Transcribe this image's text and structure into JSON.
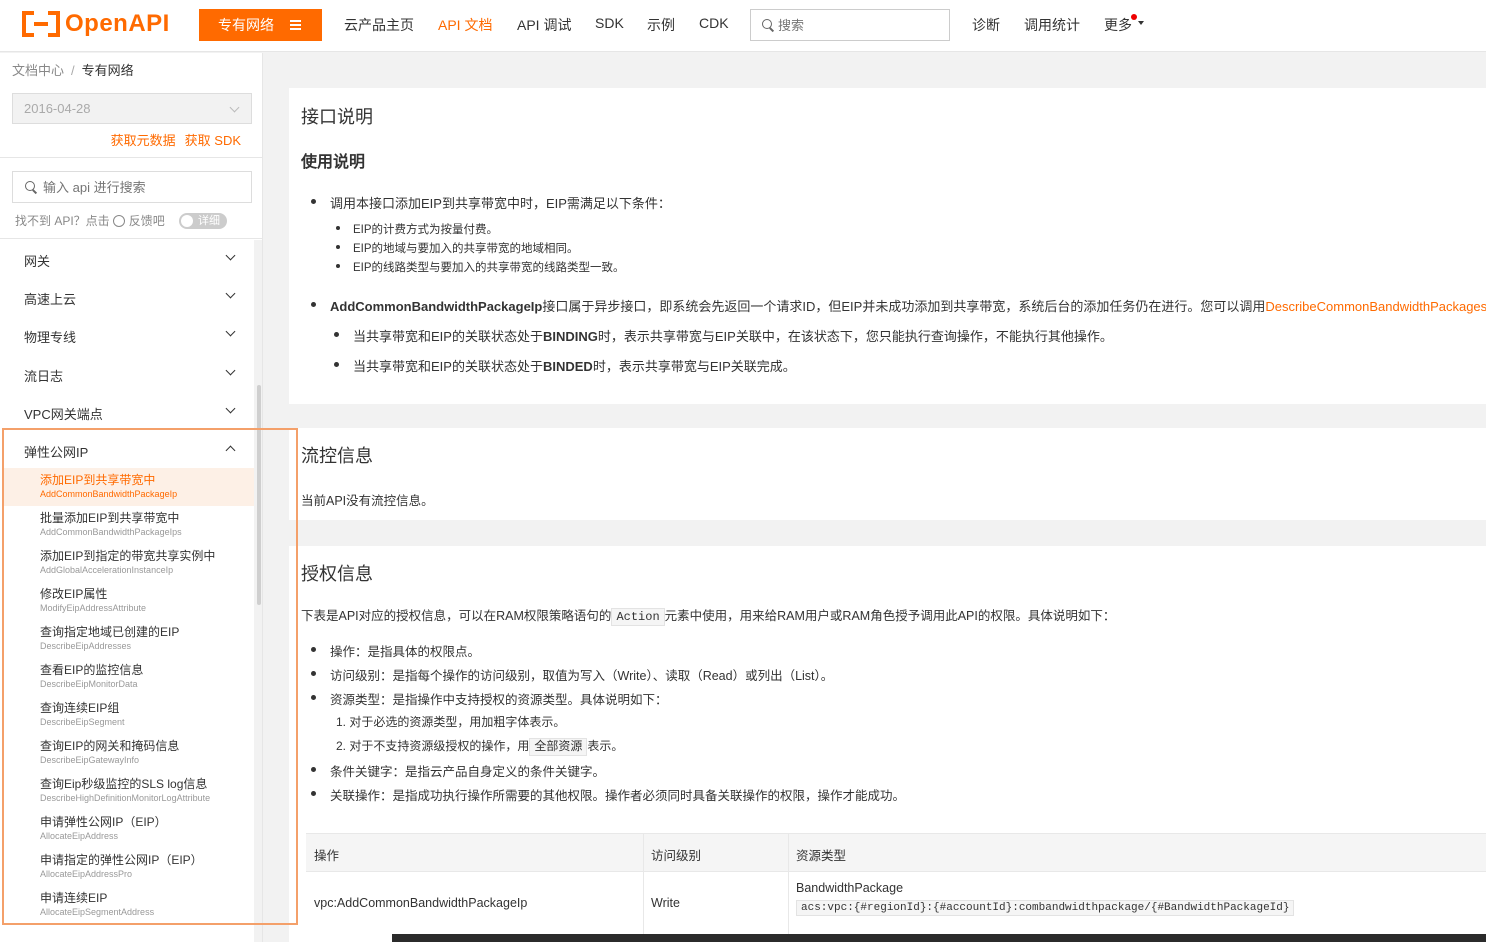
{
  "header": {
    "logo_text": "OpenAPI",
    "product_button": "专有网络",
    "nav": [
      {
        "label": "云产品主页",
        "active": false
      },
      {
        "label": "API 文档",
        "active": true
      },
      {
        "label": "API 调试",
        "active": false
      },
      {
        "label": "SDK",
        "active": false
      },
      {
        "label": "示例",
        "active": false
      },
      {
        "label": "CDK",
        "active": false
      }
    ],
    "search_placeholder": "搜索",
    "right_nav": [
      "诊断",
      "调用统计",
      "更多"
    ],
    "accent_color": "#ff6a00"
  },
  "sidebar": {
    "breadcrumb": {
      "root": "文档中心",
      "separator": "/",
      "current": "专有网络"
    },
    "version": "2016-04-28",
    "meta_links": [
      "获取元数据",
      "获取 SDK"
    ],
    "api_search_placeholder": "输入 api 进行搜索",
    "feedback_prefix": "找不到 API？点击",
    "feedback_link": "反馈吧",
    "toggle_label": "详细",
    "categories": [
      "网关",
      "高速上云",
      "物理专线",
      "流日志",
      "VPC网关端点"
    ],
    "expanded_category": "弹性公网IP",
    "api_items": [
      {
        "zh": "添加EIP到共享带宽中",
        "en": "AddCommonBandwidthPackageIp",
        "active": true
      },
      {
        "zh": "批量添加EIP到共享带宽中",
        "en": "AddCommonBandwidthPackageIps",
        "active": false
      },
      {
        "zh": "添加EIP到指定的带宽共享实例中",
        "en": "AddGlobalAccelerationInstanceIp",
        "active": false
      },
      {
        "zh": "修改EIP属性",
        "en": "ModifyEipAddressAttribute",
        "active": false
      },
      {
        "zh": "查询指定地域已创建的EIP",
        "en": "DescribeEipAddresses",
        "active": false
      },
      {
        "zh": "查看EIP的监控信息",
        "en": "DescribeEipMonitorData",
        "active": false
      },
      {
        "zh": "查询连续EIP组",
        "en": "DescribeEipSegment",
        "active": false
      },
      {
        "zh": "查询EIP的网关和掩码信息",
        "en": "DescribeEipGatewayInfo",
        "active": false
      },
      {
        "zh": "查询Eip秒级监控的SLS log信息",
        "en": "DescribeHighDefinitionMonitorLogAttribute",
        "active": false
      },
      {
        "zh": "申请弹性公网IP（EIP）",
        "en": "AllocateEipAddress",
        "active": false
      },
      {
        "zh": "申请指定的弹性公网IP（EIP）",
        "en": "AllocateEipAddressPro",
        "active": false
      },
      {
        "zh": "申请连续EIP",
        "en": "AllocateEipSegmentAddress",
        "active": false
      }
    ]
  },
  "main": {
    "section1": {
      "title": "接口说明",
      "subtitle": "使用说明",
      "bullet1": "调用本接口添加EIP到共享带宽中时，EIP需满足以下条件：",
      "sub_bullets": [
        "EIP的计费方式为按量付费。",
        "EIP的地域与要加入的共享带宽的地域相同。",
        "EIP的线路类型与要加入的共享带宽的线路类型一致。"
      ],
      "bullet2_bold": "AddCommonBandwidthPackageIp",
      "bullet2_text": "接口属于异步接口，即系统会先返回一个请求ID，但EIP并未成功添加到共享带宽，系统后台的添加任务仍在进行。您可以调用",
      "bullet2_link": "DescribeCommonBandwidthPackages",
      "state1_pre": "当共享带宽和EIP的关联状态处于",
      "state1_bold": "BINDING",
      "state1_post": "时，表示共享带宽与EIP关联中，在该状态下，您只能执行查询操作，不能执行其他操作。",
      "state2_pre": "当共享带宽和EIP的关联状态处于",
      "state2_bold": "BINDED",
      "state2_post": "时，表示共享带宽与EIP关联完成。"
    },
    "section2": {
      "title": "流控信息",
      "text": "当前API没有流控信息。"
    },
    "section3": {
      "title": "授权信息",
      "intro_pre": "下表是API对应的授权信息，可以在RAM权限策略语句的",
      "intro_code": "Action",
      "intro_post": "元素中使用，用来给RAM用户或RAM角色授予调用此API的权限。具体说明如下：",
      "bullets": [
        "操作：是指具体的权限点。",
        "访问级别：是指每个操作的访问级别，取值为写入（Write）、读取（Read）或列出（List）。",
        "资源类型：是指操作中支持授权的资源类型。具体说明如下："
      ],
      "numbered1": "1. 对于必选的资源类型，用加粗字体表示。",
      "numbered2_pre": "2. 对于不支持资源级授权的操作，用",
      "numbered2_code": "全部资源",
      "numbered2_post": "表示。",
      "bullet_condition": "条件关键字：是指云产品自身定义的条件关键字。",
      "bullet_related": "关联操作：是指成功执行操作所需要的其他权限。操作者必须同时具备关联操作的权限，操作才能成功。",
      "table": {
        "headers": [
          "操作",
          "访问级别",
          "资源类型"
        ],
        "row": {
          "action": "vpc:AddCommonBandwidthPackageIp",
          "level": "Write",
          "resource_name": "BandwidthPackage",
          "resource_arn": "acs:vpc:{#regionId}:{#accountId}:combandwidthpackage/{#BandwidthPackageId}"
        }
      }
    }
  }
}
